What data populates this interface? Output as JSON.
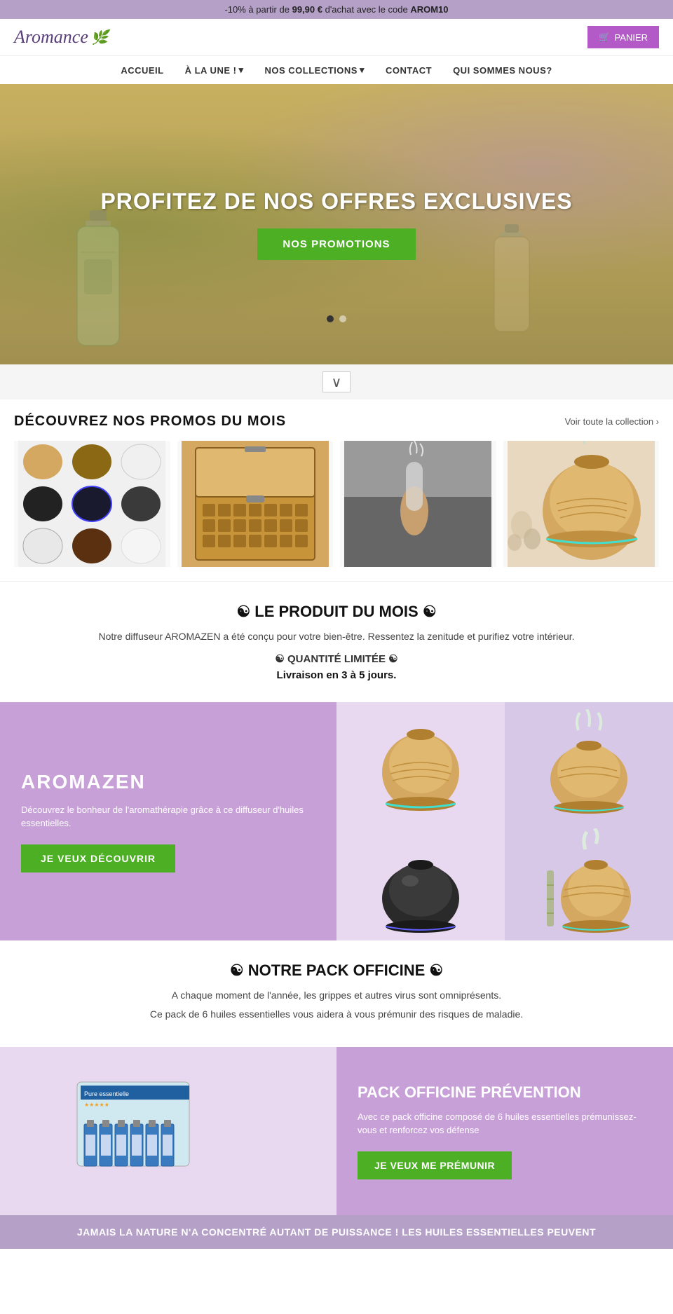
{
  "topBanner": {
    "text": "-10% à partir de",
    "amount": "99,90 €",
    "suffix": " d'achat avec le code ",
    "code": "AROM10"
  },
  "header": {
    "logo": "Aromance",
    "cartLabel": "PANIER"
  },
  "nav": {
    "items": [
      {
        "label": "ACCUEIL",
        "hasDropdown": false
      },
      {
        "label": "À LA UNE !",
        "hasDropdown": true
      },
      {
        "label": "NOS COLLECTIONS",
        "hasDropdown": true
      },
      {
        "label": "CONTACT",
        "hasDropdown": false
      },
      {
        "label": "QUI SOMMES NOUS?",
        "hasDropdown": false
      }
    ]
  },
  "hero": {
    "title": "PROFITEZ DE NOS OFFRES EXCLUSIVES",
    "buttonLabel": "NOS PROMOTIONS",
    "dots": [
      {
        "active": true
      },
      {
        "active": false
      }
    ]
  },
  "scrollDown": {
    "icon": "∨"
  },
  "promosSection": {
    "title": "DÉCOUVREZ NOS PROMOS DU MOIS",
    "viewAll": "Voir toute la collection ›"
  },
  "productMonth": {
    "title": "☯ LE PRODUIT DU MOIS ☯",
    "description": "Notre diffuseur AROMAZEN a été conçu pour votre bien-être. Ressentez la zenitude et purifiez votre intérieur.",
    "quantite": "☯ QUANTITÉ LIMITÉE ☯",
    "livraison": "Livraison en 3 à 5 jours."
  },
  "aromazen": {
    "title": "AROMAZEN",
    "description": "Découvrez le bonheur de l'aromathérapie grâce à ce diffuseur d'huiles essentielles.",
    "buttonLabel": "JE VEUX DÉCOUVRIR"
  },
  "packOfficine": {
    "title": "☯ NOTRE PACK OFFICINE ☯",
    "desc1": "A chaque moment de l'année, les grippes et autres virus sont omniprésents.",
    "desc2": "Ce pack de 6 huiles essentielles vous aidera à vous prémunir des risques de maladie.",
    "product": {
      "title": "PACK OFFICINE PRÉVENTION",
      "description": "Avec ce pack officine composé de 6 huiles essentielles prémunissez-vous et renforcez vos défense",
      "buttonLabel": "JE VEUX ME PRÉMUNIR"
    }
  },
  "bottomBanner": {
    "text": "JAMAIS LA NATURE N'A CONCENTRÉ AUTANT DE PUISSANCE ! LES HUILES ESSENTIELLES PEUVENT"
  },
  "colors": {
    "purple": "#b5a0c8",
    "green": "#4caf24",
    "darkPurple": "#c8a0d8",
    "lightPurple": "#e8d0f0"
  }
}
